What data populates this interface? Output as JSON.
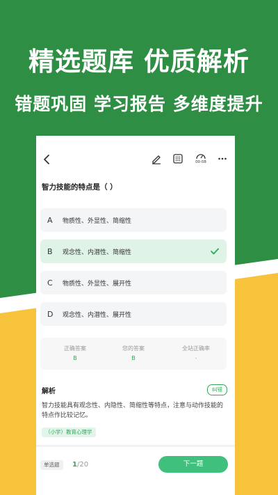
{
  "colors": {
    "background_green": "#2e8f44",
    "accent_yellow": "#f7c33a",
    "accent_green": "#2fa85a",
    "button_green": "#3fc07c"
  },
  "promo": {
    "headline": "精选题库 优质解析",
    "subheadline": "错题巩固 学习报告 多维度提升"
  },
  "toolbar": {
    "back_icon": "chevron-left-icon",
    "icons": [
      "pencil-icon",
      "calculator-icon",
      "timer-icon",
      "more-icon"
    ],
    "timer_text": "00:08"
  },
  "question": {
    "text": "智力技能的特点是（ ）",
    "options": [
      {
        "letter": "A",
        "text": "物质性、外显性、简缩性",
        "selected": false
      },
      {
        "letter": "B",
        "text": "观念性、内潜性、简缩性",
        "selected": true
      },
      {
        "letter": "C",
        "text": "物质性、外显性、展开性",
        "selected": false
      },
      {
        "letter": "D",
        "text": "观念性、内潜性、展开性",
        "selected": false
      }
    ]
  },
  "stats": {
    "correct_answer_label": "正确答案",
    "correct_answer_value": "B",
    "your_answer_label": "您的答案",
    "your_answer_value": "B",
    "site_rate_label": "全站正确率",
    "site_rate_value": "-"
  },
  "analysis": {
    "title": "解析",
    "report_button": "纠错",
    "text": "智力技能具有观念性、内隐性、简缩性等特点，注意与动作技能的特点作比较记忆。",
    "tag": "（小学）教育心理学"
  },
  "footer": {
    "question_type": "单选题",
    "current": "1",
    "total": "/20",
    "next_button": "下一题"
  }
}
